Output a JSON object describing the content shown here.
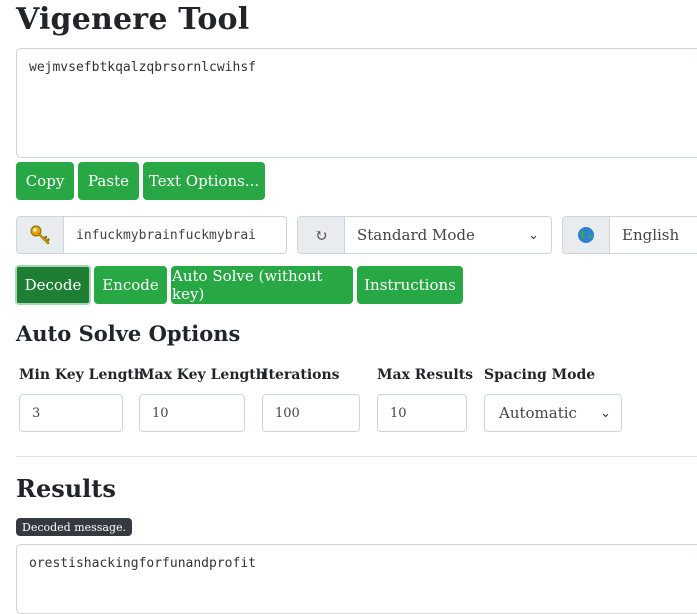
{
  "title": "Vigenere Tool",
  "input": {
    "text": "wejmvsefbtkqalzqbrsornlcwihsf"
  },
  "text_buttons": {
    "copy": "Copy",
    "paste": "Paste",
    "text_options": "Text Options..."
  },
  "key": {
    "icon": "key-icon",
    "value": "infuckmybrainfuckmybrai"
  },
  "mode": {
    "icon": "refresh-icon",
    "selected": "Standard Mode"
  },
  "language": {
    "icon": "globe-icon",
    "selected": "English"
  },
  "actions": {
    "decode": "Decode",
    "encode": "Encode",
    "auto_solve": "Auto Solve (without key)",
    "instructions": "Instructions"
  },
  "auto_solve": {
    "heading": "Auto Solve Options",
    "min_key_label": "Min Key Length",
    "min_key_value": "3",
    "max_key_label": "Max Key Length",
    "max_key_value": "10",
    "iterations_label": "Iterations",
    "iterations_value": "100",
    "max_results_label": "Max Results",
    "max_results_value": "10",
    "spacing_label": "Spacing Mode",
    "spacing_value": "Automatic"
  },
  "results": {
    "heading": "Results",
    "badge": "Decoded message.",
    "text": "orestishackingforfunandprofit"
  },
  "colors": {
    "primary": "#28a745",
    "primary_active": "#1e7e34",
    "badge": "#343a40"
  }
}
